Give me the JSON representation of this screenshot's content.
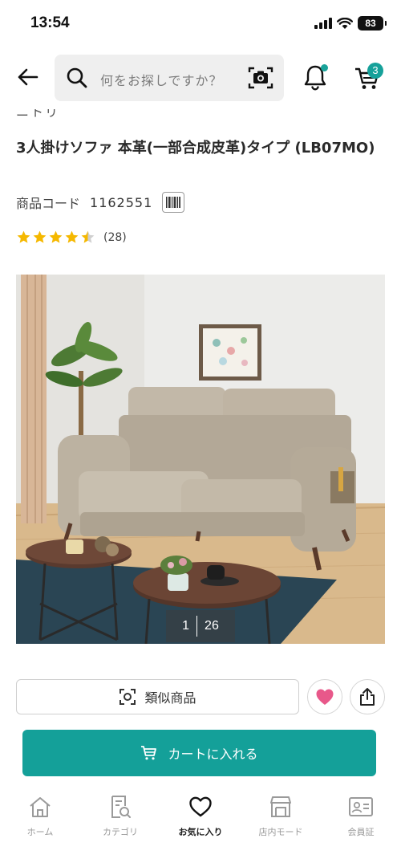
{
  "status_bar": {
    "time": "13:54",
    "battery": "83"
  },
  "header": {
    "search_placeholder": "何をお探しですか？",
    "cart_count": "3"
  },
  "product": {
    "brand_partial": "ニトリ",
    "title": "3人掛けソファ 本革(一部合成皮革)タイプ (LB07MO)",
    "code_label": "商品コード",
    "code_value": "1162551",
    "rating_stars": 4.5,
    "review_count": "(28)"
  },
  "gallery": {
    "current": "1",
    "total": "26"
  },
  "actions": {
    "similar_label": "類似商品",
    "add_to_cart_label": "カートに入れる",
    "favorite_color": "#e8588a",
    "accent_color": "#14a099"
  },
  "bottom_nav": {
    "items": [
      {
        "label": "ホーム",
        "icon": "home-icon"
      },
      {
        "label": "カテゴリ",
        "icon": "category-icon"
      },
      {
        "label": "お気に入り",
        "icon": "heart-icon"
      },
      {
        "label": "店内モード",
        "icon": "store-icon"
      },
      {
        "label": "会員証",
        "icon": "member-card-icon"
      }
    ]
  }
}
